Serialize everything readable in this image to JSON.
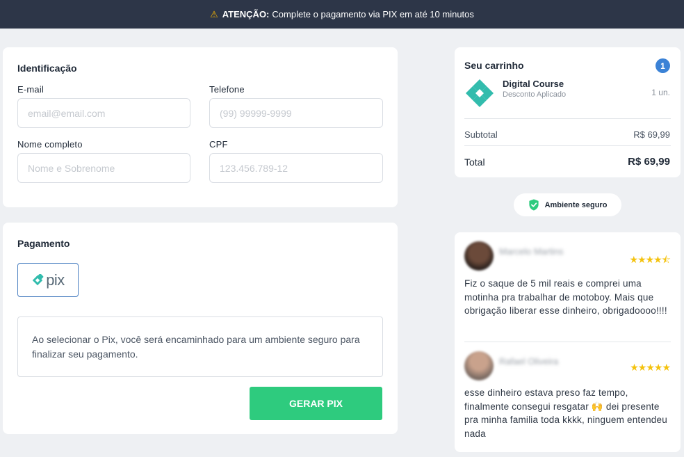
{
  "alert": {
    "icon": "warning-icon",
    "strong": "ATENÇÃO:",
    "text": "Complete o pagamento via PIX em até 10 minutos"
  },
  "identification": {
    "title": "Identificação",
    "email": {
      "label": "E-mail",
      "placeholder": "email@email.com"
    },
    "phone": {
      "label": "Telefone",
      "placeholder": "(99) 99999-9999"
    },
    "name": {
      "label": "Nome completo",
      "placeholder": "Nome e Sobrenome"
    },
    "cpf": {
      "label": "CPF",
      "placeholder": "123.456.789-12"
    }
  },
  "payment": {
    "title": "Pagamento",
    "method": "pix",
    "info": "Ao selecionar o Pix, você será encaminhado para um ambiente seguro para finalizar seu pagamento.",
    "button": "GERAR PIX"
  },
  "cart": {
    "title": "Seu carrinho",
    "count": "1",
    "product": {
      "name": "Digital Course",
      "subtitle": "Desconto Aplicado",
      "qty": "1 un."
    },
    "subtotal_label": "Subtotal",
    "subtotal_value": "R$ 69,99",
    "total_label": "Total",
    "total_value": "R$ 69,99"
  },
  "secure": {
    "label": "Ambiente seguro"
  },
  "reviews": [
    {
      "name": "Marcelo Martins",
      "rating": 4.5,
      "stars": "★★★★⯪",
      "text": "Fiz o saque de 5 mil reais e comprei uma motinha pra trabalhar de motoboy. Mais que obrigação liberar esse dinheiro, obrigadoooo!!!!"
    },
    {
      "name": "Rafael Oliveira",
      "rating": 5,
      "stars": "★★★★★",
      "text": "esse dinheiro estava preso faz tempo, finalmente consegui resgatar 🙌 dei presente pra minha familia toda kkkk, ninguem entendeu nada"
    }
  ],
  "colors": {
    "topbar": "#2d3648",
    "accent_green": "#2ecb7e",
    "badge_blue": "#3b82d6",
    "pix_teal": "#32bcad",
    "star_yellow": "#f4c20d"
  }
}
